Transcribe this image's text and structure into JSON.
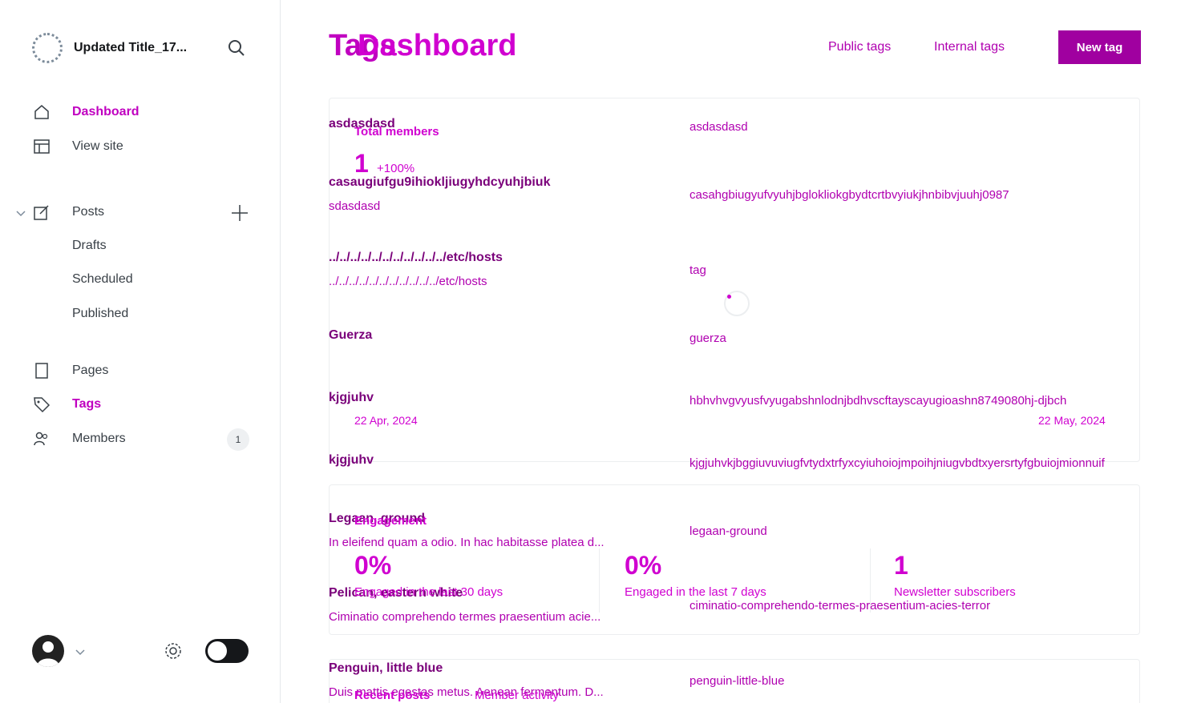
{
  "sidebar": {
    "site_title": "Updated Title_17...",
    "nav": {
      "dashboard": "Dashboard",
      "view_site": "View site",
      "posts": "Posts",
      "drafts": "Drafts",
      "scheduled": "Scheduled",
      "published": "Published",
      "pages": "Pages",
      "tags": "Tags",
      "members": "Members",
      "members_count": "1"
    }
  },
  "header": {
    "title": "Tags",
    "overlay_title": "Dashboard",
    "public_tags": "Public tags",
    "internal_tags": "Internal tags",
    "new_tag": "New tag"
  },
  "tags": [
    {
      "name": "asdasdasd",
      "description": "",
      "slug": "asdasdasd"
    },
    {
      "name": "casaugiufgu9ihiokljiugyhdcyuhjbiuk",
      "description": "sdasdasd",
      "slug": "casahgbiugyufvyuhjbglokliokgbydtcrtbvyiukjhnbibvjuuhj0987"
    },
    {
      "name": "../../../../../../../../../../../etc/hosts",
      "description": "../../../../../../../../../../../etc/hosts",
      "slug": "tag"
    },
    {
      "name": "Guerza",
      "description": "",
      "slug": "guerza"
    },
    {
      "name": "kjgjuhv",
      "description": "",
      "slug": "hbhvhvgvyusfvyugabshnlodnjbdhvscftayscayugioashn8749080hj-djbch"
    },
    {
      "name": "kjgjuhv",
      "description": "",
      "slug": "kjgjuhvkjbggiuvuviugfvtydxtrfyxcyiuhoiojmpoihjniugvbdtxyersrtyfgbuiojmionnuif"
    },
    {
      "name": "Legaan, ground",
      "description": "In eleifend quam a odio. In hac habitasse platea d...",
      "slug": "legaan-ground"
    },
    {
      "name": "Pelican, eastern white",
      "description": "Ciminatio comprehendo termes praesentium acie...",
      "slug": "ciminatio-comprehendo-termes-praesentium-acies-terror"
    },
    {
      "name": "Penguin, little blue",
      "description": "Duis mattis egestas metus. Aenean fermentum. D...",
      "slug": "penguin-little-blue"
    }
  ],
  "dashboard": {
    "total_members_label": "Total members",
    "total_members_value": "1",
    "total_members_delta": "+100%",
    "date_start": "22 Apr, 2024",
    "date_end": "22 May, 2024",
    "engagement_label": "Engagement",
    "engaged_30_value": "0%",
    "engaged_30_label": "Engaged in the last 30 days",
    "engaged_7_value": "0%",
    "engaged_7_label": "Engaged in the last 7 days",
    "subscribers_value": "1",
    "subscribers_label": "Newsletter subscribers",
    "recent_posts": "Recent posts",
    "member_activity": "Member activity"
  },
  "colors": {
    "accent": "#c000c0",
    "button": "#a000a0"
  }
}
